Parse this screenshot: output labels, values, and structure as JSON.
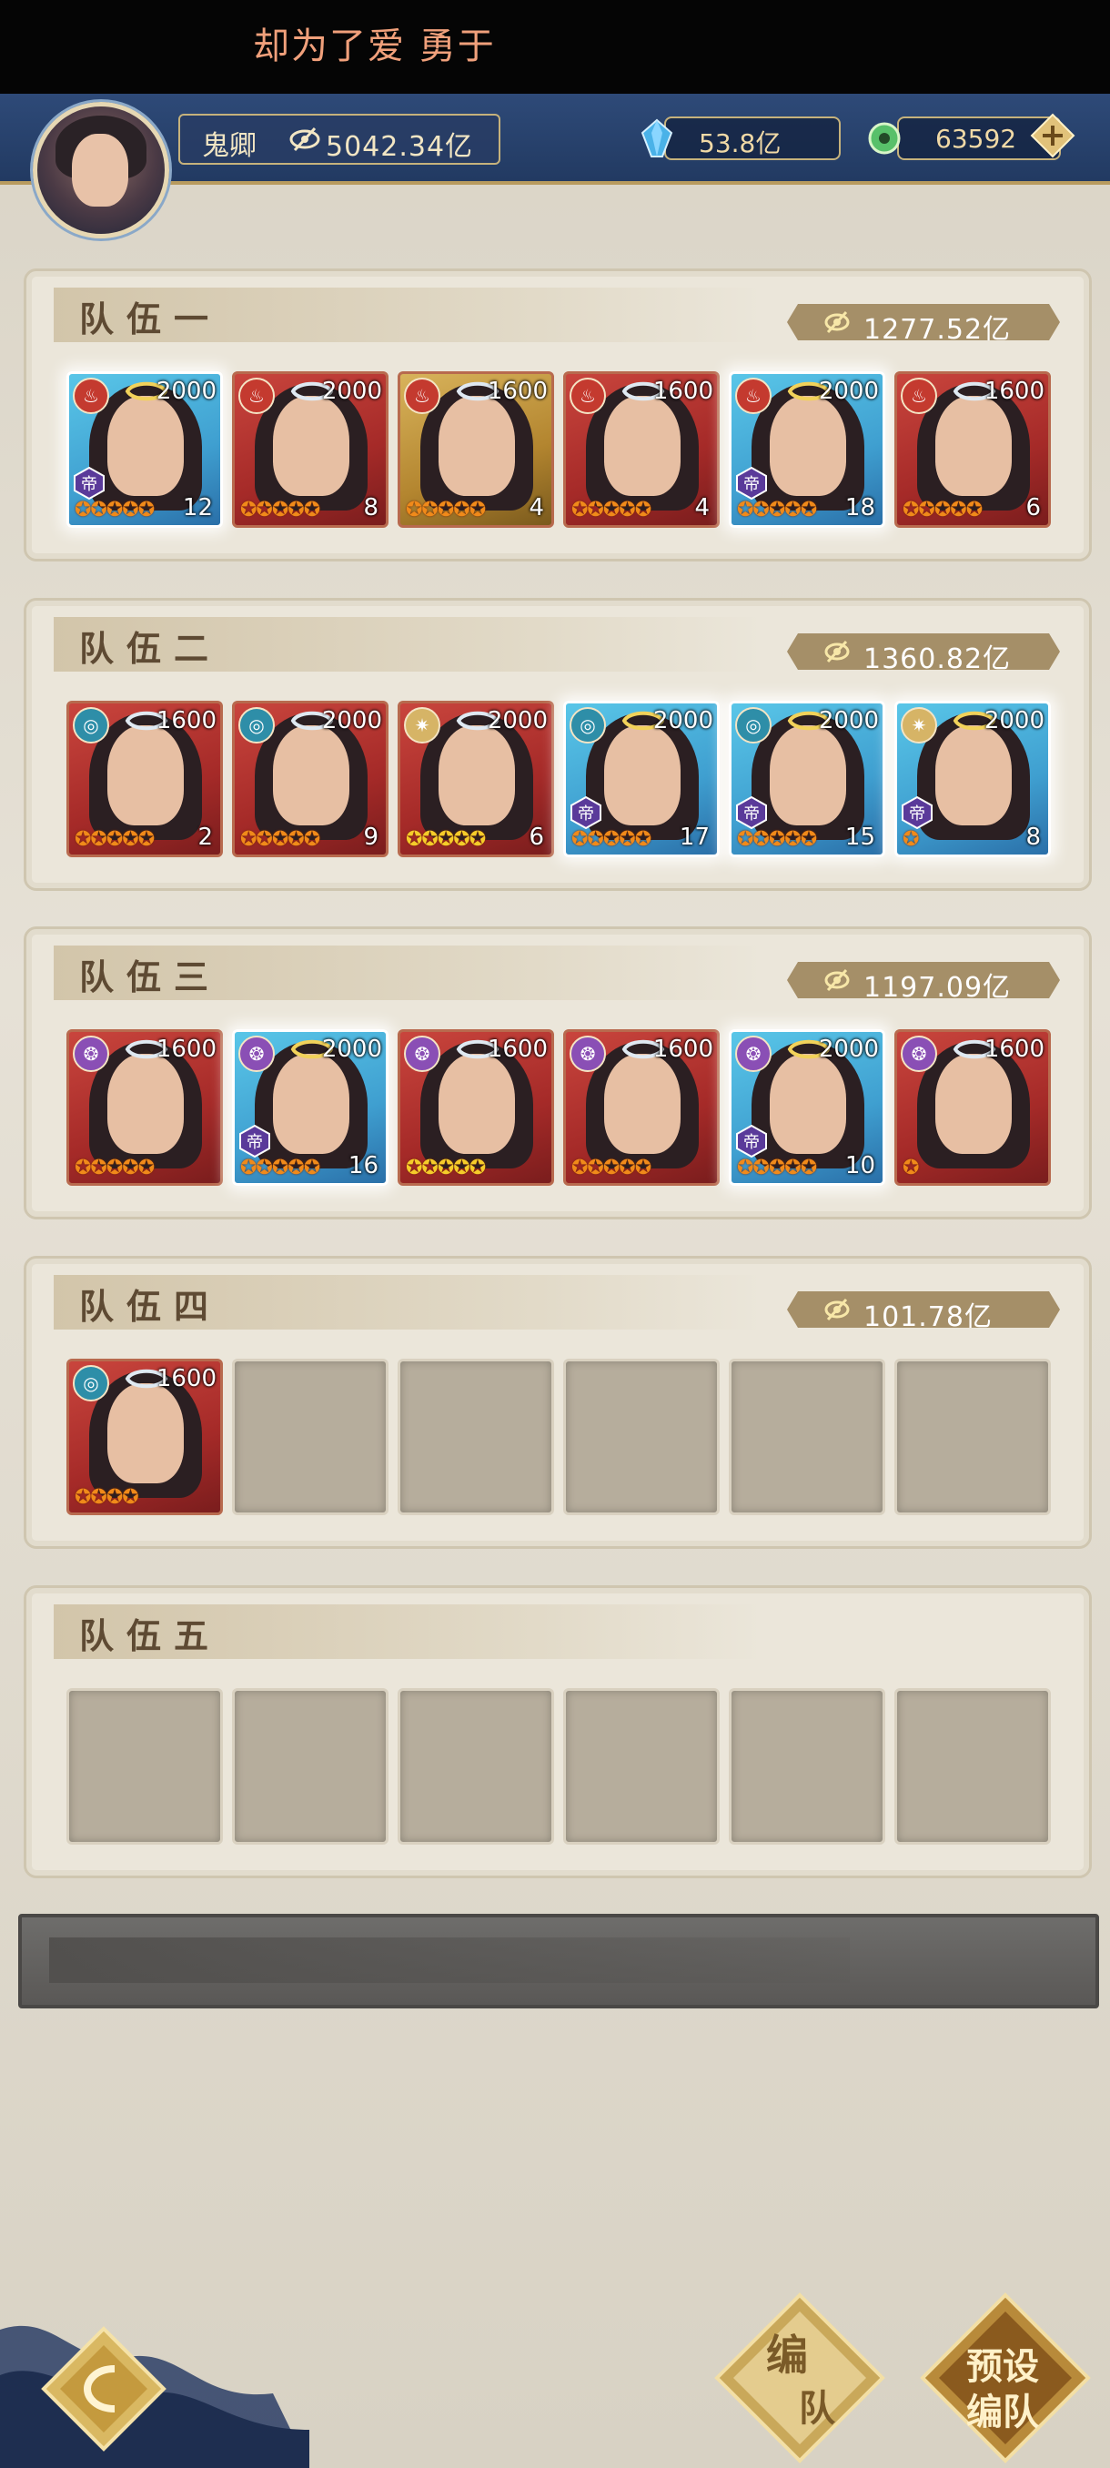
{
  "marquee": "却为了爱 勇于",
  "player": {
    "name": "鬼卿",
    "power": "5042.34亿",
    "crystal": "53.8亿",
    "jade": "63592"
  },
  "teams": [
    {
      "title": "队伍一",
      "power": "1277.52亿",
      "heroes": [
        {
          "faction": "fire",
          "level": "2000",
          "stars": 5,
          "count": "12",
          "frame": "blue",
          "emperor": true
        },
        {
          "faction": "fire",
          "level": "2000",
          "stars": 5,
          "count": "8",
          "frame": "red",
          "emperor": false
        },
        {
          "faction": "fire",
          "level": "1600",
          "stars": 5,
          "count": "4",
          "frame": "gold",
          "emperor": false
        },
        {
          "faction": "fire",
          "level": "1600",
          "stars": 5,
          "count": "4",
          "frame": "red",
          "emperor": false
        },
        {
          "faction": "fire",
          "level": "2000",
          "stars": 5,
          "count": "18",
          "frame": "blue",
          "emperor": true
        },
        {
          "faction": "fire",
          "level": "1600",
          "stars": 5,
          "count": "6",
          "frame": "red",
          "emperor": false
        }
      ]
    },
    {
      "title": "队伍二",
      "power": "1360.82亿",
      "heroes": [
        {
          "faction": "cyan",
          "level": "1600",
          "stars": 5,
          "count": "2",
          "frame": "red",
          "emperor": false
        },
        {
          "faction": "cyan",
          "level": "2000",
          "stars": 5,
          "count": "9",
          "frame": "red",
          "emperor": false
        },
        {
          "faction": "sun",
          "level": "2000",
          "stars": 5,
          "count": "6",
          "frame": "red",
          "emperor": false,
          "gold_stars": true
        },
        {
          "faction": "cyan",
          "level": "2000",
          "stars": 5,
          "count": "17",
          "frame": "blue",
          "emperor": true
        },
        {
          "faction": "cyan",
          "level": "2000",
          "stars": 5,
          "count": "15",
          "frame": "blue",
          "emperor": true
        },
        {
          "faction": "sun",
          "level": "2000",
          "stars": 1,
          "count": "8",
          "frame": "blue",
          "emperor": true
        }
      ]
    },
    {
      "title": "队伍三",
      "power": "1197.09亿",
      "heroes": [
        {
          "faction": "purple",
          "level": "1600",
          "stars": 5,
          "count": "",
          "frame": "red",
          "emperor": false
        },
        {
          "faction": "purple",
          "level": "2000",
          "stars": 5,
          "count": "16",
          "frame": "blue",
          "emperor": true
        },
        {
          "faction": "purple",
          "level": "1600",
          "stars": 5,
          "count": "",
          "frame": "red",
          "emperor": false,
          "gold_stars": true
        },
        {
          "faction": "purple",
          "level": "1600",
          "stars": 5,
          "count": "",
          "frame": "red",
          "emperor": false
        },
        {
          "faction": "purple",
          "level": "2000",
          "stars": 5,
          "count": "10",
          "frame": "blue",
          "emperor": true
        },
        {
          "faction": "purple",
          "level": "1600",
          "stars": 1,
          "count": "",
          "frame": "red",
          "emperor": false
        }
      ]
    },
    {
      "title": "队伍四",
      "power": "101.78亿",
      "heroes": [
        {
          "faction": "cyan",
          "level": "1600",
          "stars": 4,
          "count": "",
          "frame": "red",
          "emperor": false,
          "white_hair": true
        }
      ]
    },
    {
      "title": "队伍五",
      "power": "",
      "heroes": []
    }
  ],
  "buttons": {
    "team_label_1": "编",
    "team_label_2": "队",
    "preset_label_1": "预设",
    "preset_label_2": "编队"
  },
  "emperor_glyph": "帝",
  "star_glyph": "✪"
}
